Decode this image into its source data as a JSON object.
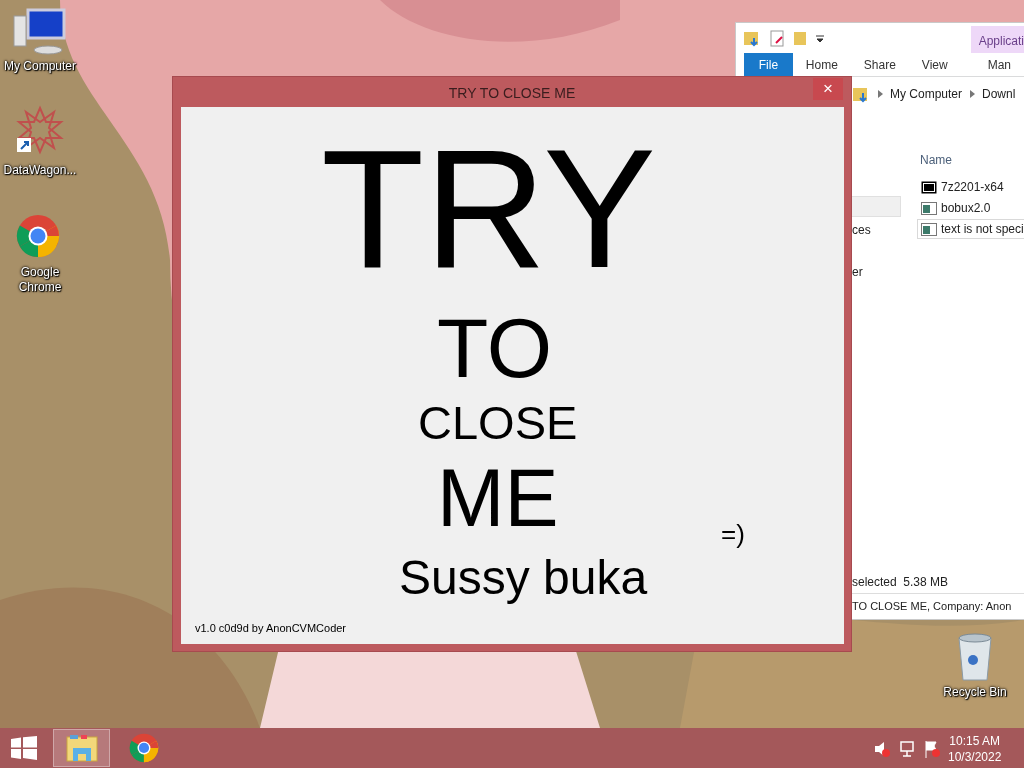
{
  "desktop": {
    "icons": [
      {
        "label": "My Computer",
        "kind": "computer"
      },
      {
        "label": "DataWagon...",
        "kind": "star"
      },
      {
        "label": "Google Chrome",
        "kind": "chrome"
      },
      {
        "label": "Recycle Bin",
        "kind": "bin"
      }
    ]
  },
  "explorer": {
    "contextual_tab": "Applicati",
    "file_tab": "File",
    "ribbon_tabs": [
      "Home",
      "Share",
      "View",
      "Man"
    ],
    "breadcrumb": [
      "My Computer",
      "Downl"
    ],
    "nav_fragments": [
      "ces",
      "er"
    ],
    "column_header": "Name",
    "files": [
      {
        "name": "7z2201-x64",
        "kind": "archive",
        "selected": false
      },
      {
        "name": "bobux2.0",
        "kind": "app",
        "selected": false
      },
      {
        "name": "text is not speci",
        "kind": "app",
        "selected": true
      }
    ],
    "status": "selected  5.38 MB",
    "details": "TO CLOSE ME, Company: Anon"
  },
  "dialog": {
    "title": "TRY TO CLOSE ME",
    "close": "×",
    "labels": [
      "TRY",
      "TO",
      "CLOSE",
      "ME",
      "=)",
      "Sussy buka"
    ],
    "footer": "v1.0 c0d9d by AnonCVMCoder"
  },
  "taskbar": {
    "apps": [
      {
        "kind": "explorer",
        "selected": true
      },
      {
        "kind": "chrome",
        "selected": false
      }
    ],
    "tray": [
      {
        "kind": "volume"
      },
      {
        "kind": "network"
      },
      {
        "kind": "flag"
      }
    ],
    "time": "10:15 AM",
    "date": "10/3/2022"
  }
}
